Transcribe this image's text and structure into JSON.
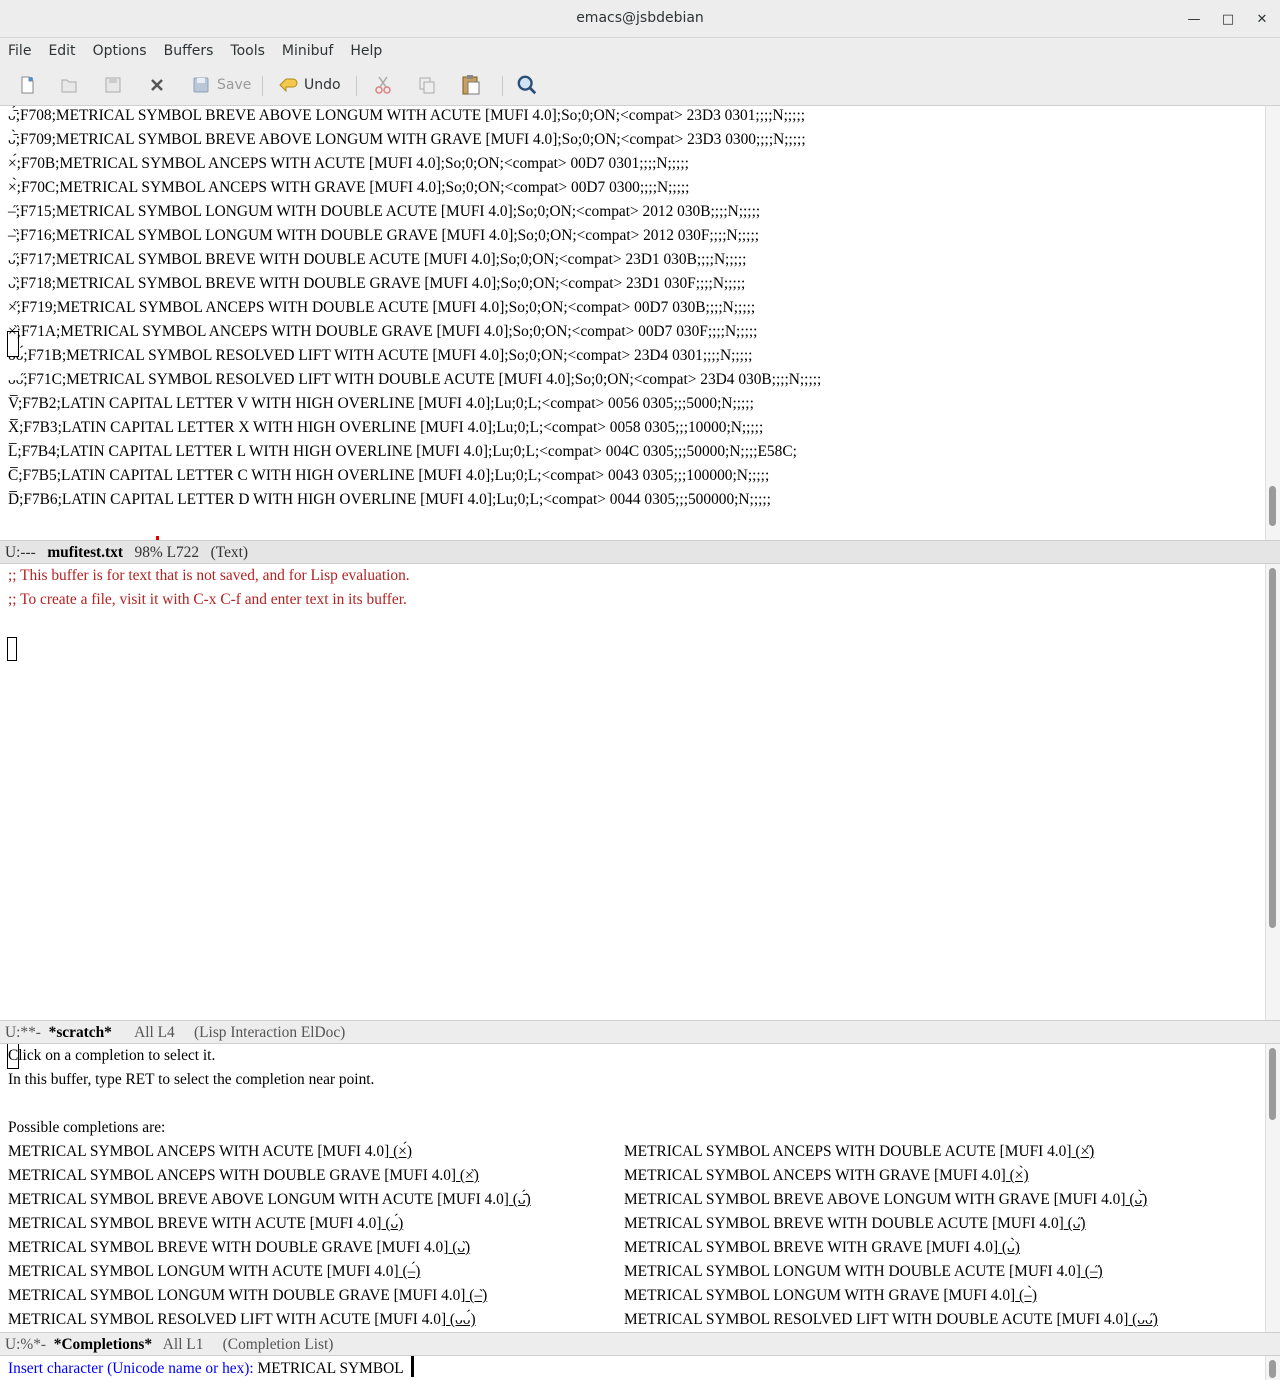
{
  "window": {
    "title": "emacs@jsbdebian",
    "minimize": "—",
    "maximize": "□",
    "close": "✕"
  },
  "menu": [
    "File",
    "Edit",
    "Options",
    "Buffers",
    "Tools",
    "Minibuf",
    "Help"
  ],
  "toolbar": {
    "save_label": "Save",
    "undo_label": "Undo"
  },
  "top_buffer": {
    "lines": [
      "ᴗ̄́;F708;METRICAL SYMBOL BREVE ABOVE LONGUM WITH ACUTE [MUFI 4.0];So;0;ON;<compat> 23D3 0301;;;;N;;;;;",
      "ᴗ̄̀;F709;METRICAL SYMBOL BREVE ABOVE LONGUM WITH GRAVE [MUFI 4.0];So;0;ON;<compat> 23D3 0300;;;;N;;;;;",
      "×́;F70B;METRICAL SYMBOL ANCEPS WITH ACUTE [MUFI 4.0];So;0;ON;<compat> 00D7 0301;;;;N;;;;;",
      "×̀;F70C;METRICAL SYMBOL ANCEPS WITH GRAVE [MUFI 4.0];So;0;ON;<compat> 00D7 0300;;;;N;;;;;",
      "–̋;F715;METRICAL SYMBOL LONGUM WITH DOUBLE ACUTE [MUFI 4.0];So;0;ON;<compat> 2012 030B;;;;N;;;;;",
      "–̏;F716;METRICAL SYMBOL LONGUM WITH DOUBLE GRAVE [MUFI 4.0];So;0;ON;<compat> 2012 030F;;;;N;;;;;",
      "ᴗ̋;F717;METRICAL SYMBOL BREVE WITH DOUBLE ACUTE [MUFI 4.0];So;0;ON;<compat> 23D1 030B;;;;N;;;;;",
      "ᴗ̏;F718;METRICAL SYMBOL BREVE WITH DOUBLE GRAVE [MUFI 4.0];So;0;ON;<compat> 23D1 030F;;;;N;;;;;",
      "×̋;F719;METRICAL SYMBOL ANCEPS WITH DOUBLE ACUTE [MUFI 4.0];So;0;ON;<compat> 00D7 030B;;;;N;;;;;",
      "×̏;F71A;METRICAL SYMBOL ANCEPS WITH DOUBLE GRAVE [MUFI 4.0];So;0;ON;<compat> 00D7 030F;;;;N;;;;;",
      "ᴗᴗ́;F71B;METRICAL SYMBOL RESOLVED LIFT WITH ACUTE [MUFI 4.0];So;0;ON;<compat> 23D4 0301;;;;N;;;;;",
      "ᴗᴗ̋;F71C;METRICAL SYMBOL RESOLVED LIFT WITH DOUBLE ACUTE [MUFI 4.0];So;0;ON;<compat> 23D4 030B;;;;N;;;;;",
      "V̅;F7B2;LATIN CAPITAL LETTER V WITH HIGH OVERLINE [MUFI 4.0];Lu;0;L;<compat> 0056 0305;;;5000;N;;;;;",
      "X̅;F7B3;LATIN CAPITAL LETTER X WITH HIGH OVERLINE [MUFI 4.0];Lu;0;L;<compat> 0058 0305;;;10000;N;;;;;",
      "L̅;F7B4;LATIN CAPITAL LETTER L WITH HIGH OVERLINE [MUFI 4.0];Lu;0;L;<compat> 004C 0305;;;50000;N;;;;E58C;",
      "C̅;F7B5;LATIN CAPITAL LETTER C WITH HIGH OVERLINE [MUFI 4.0];Lu;0;L;<compat> 0043 0305;;;100000;N;;;;;",
      "D̅;F7B6;LATIN CAPITAL LETTER D WITH HIGH OVERLINE [MUFI 4.0];Lu;0;L;<compat> 0044 0305;;;500000;N;;;;;"
    ],
    "modeline": {
      "status": "U:---",
      "buffer": "mufitest.txt",
      "position": "98% L722",
      "mode": "(Text)"
    }
  },
  "scratch_buffer": {
    "comment1": ";; This buffer is for text that is not saved, and for Lisp evaluation.",
    "comment2": ";; To create a file, visit it with C-x C-f and enter text in its buffer.",
    "modeline": {
      "status": "U:**-",
      "buffer": "*scratch*",
      "position": "All L4",
      "mode": "(Lisp Interaction ElDoc)"
    }
  },
  "completions_buffer": {
    "intro1": "Click on a completion to select it.",
    "intro2": "In this buffer, type RET to select the completion near point.",
    "header": "Possible completions are:",
    "left": [
      {
        "name": "METRICAL SYMBOL ANCEPS WITH ACUTE [MUFI 4.0]",
        "glyph": " (×́)"
      },
      {
        "name": "METRICAL SYMBOL ANCEPS WITH DOUBLE GRAVE [MUFI 4.0]",
        "glyph": " (×̏)"
      },
      {
        "name": "METRICAL SYMBOL BREVE ABOVE LONGUM WITH ACUTE [MUFI 4.0]",
        "glyph": " (ᴗ̄́)"
      },
      {
        "name": "METRICAL SYMBOL BREVE WITH ACUTE [MUFI 4.0]",
        "glyph": " (ᴗ́)"
      },
      {
        "name": "METRICAL SYMBOL BREVE WITH DOUBLE GRAVE [MUFI 4.0]",
        "glyph": " (ᴗ̏)"
      },
      {
        "name": "METRICAL SYMBOL LONGUM WITH ACUTE [MUFI 4.0]",
        "glyph": " (–́)"
      },
      {
        "name": "METRICAL SYMBOL LONGUM WITH DOUBLE GRAVE [MUFI 4.0]",
        "glyph": " (–̏)"
      },
      {
        "name": "METRICAL SYMBOL RESOLVED LIFT WITH ACUTE [MUFI 4.0]",
        "glyph": " (ᴗᴗ́)"
      }
    ],
    "right": [
      {
        "name": "METRICAL SYMBOL ANCEPS WITH DOUBLE ACUTE [MUFI 4.0]",
        "glyph": " (×̋)"
      },
      {
        "name": "METRICAL SYMBOL ANCEPS WITH GRAVE [MUFI 4.0]",
        "glyph": " (×̀)"
      },
      {
        "name": "METRICAL SYMBOL BREVE ABOVE LONGUM WITH GRAVE [MUFI 4.0]",
        "glyph": " (ᴗ̄̀)"
      },
      {
        "name": "METRICAL SYMBOL BREVE WITH DOUBLE ACUTE [MUFI 4.0]",
        "glyph": " (ᴗ̋)"
      },
      {
        "name": "METRICAL SYMBOL BREVE WITH GRAVE [MUFI 4.0]",
        "glyph": " (ᴗ̀)"
      },
      {
        "name": "METRICAL SYMBOL LONGUM WITH DOUBLE ACUTE [MUFI 4.0]",
        "glyph": " (–̋)"
      },
      {
        "name": "METRICAL SYMBOL LONGUM WITH GRAVE [MUFI 4.0]",
        "glyph": " (–̀)"
      },
      {
        "name": "METRICAL SYMBOL RESOLVED LIFT WITH DOUBLE ACUTE [MUFI 4.0]",
        "glyph": " (ᴗᴗ̋)"
      }
    ],
    "modeline": {
      "status": "U:%*-",
      "buffer": "*Completions*",
      "position": "All L1",
      "mode": "(Completion List)"
    }
  },
  "minibuffer": {
    "prompt": "Insert character (Unicode name or hex): ",
    "input": "METRICAL SYMBOL "
  }
}
